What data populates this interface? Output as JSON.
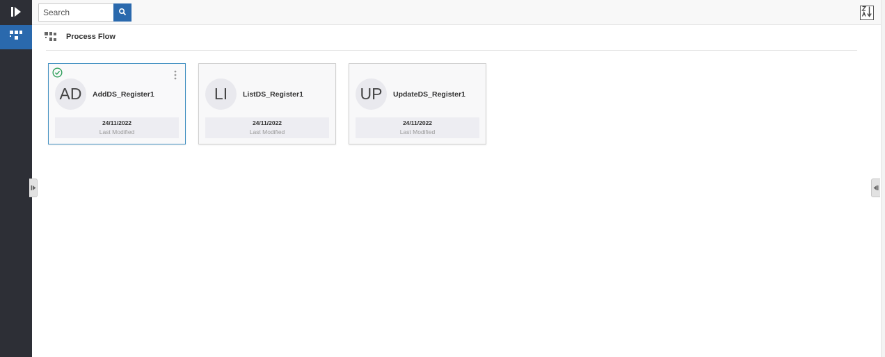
{
  "search": {
    "placeholder": "Search"
  },
  "section": {
    "title": "Process Flow"
  },
  "cards": [
    {
      "initials": "AD",
      "name": "AddDS_Register1",
      "date": "24/11/2022",
      "date_label": "Last Modified",
      "selected": true
    },
    {
      "initials": "LI",
      "name": "ListDS_Register1",
      "date": "24/11/2022",
      "date_label": "Last Modified",
      "selected": false
    },
    {
      "initials": "UP",
      "name": "UpdateDS_Register1",
      "date": "24/11/2022",
      "date_label": "Last Modified",
      "selected": false
    }
  ],
  "icons": {
    "logo": "play-logo-icon",
    "rail": "process-flow-icon",
    "search": "search-icon",
    "sort": "sort-z-a-icon",
    "selected": "check-circle-icon",
    "menu": "kebab-menu-icon"
  },
  "colors": {
    "rail": "#2d2f36",
    "accent": "#2a69ad",
    "selected_border": "#3e8ec0",
    "check": "#2e9e5b"
  }
}
